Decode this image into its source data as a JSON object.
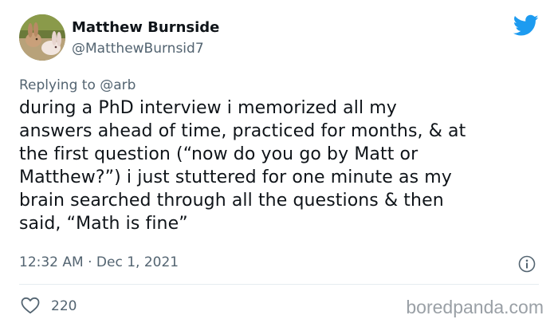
{
  "tweet": {
    "author": {
      "display_name": "Matthew Burnside",
      "handle": "@MatthewBurnsid7",
      "avatar_icon": "avatar-rabbits-photo"
    },
    "platform_icon": "twitter-bird-icon",
    "brand_color": "#1d9bf0",
    "reply_prefix": "Replying to",
    "reply_mention": "@arb",
    "text_lines": [
      "during a PhD interview i memorized all my",
      "answers ahead of time, practiced for months, & at",
      "the first question (“now do you go by Matt or",
      "Matthew?”) i just stuttered for one minute as my",
      "brain searched through all the questions & then",
      "said, “Math is fine”"
    ],
    "timestamp": "12:32 AM · Dec 1, 2021",
    "info_icon": "info-icon",
    "like_icon": "heart-icon",
    "like_count": "220"
  },
  "watermark": "boredpanda.com"
}
